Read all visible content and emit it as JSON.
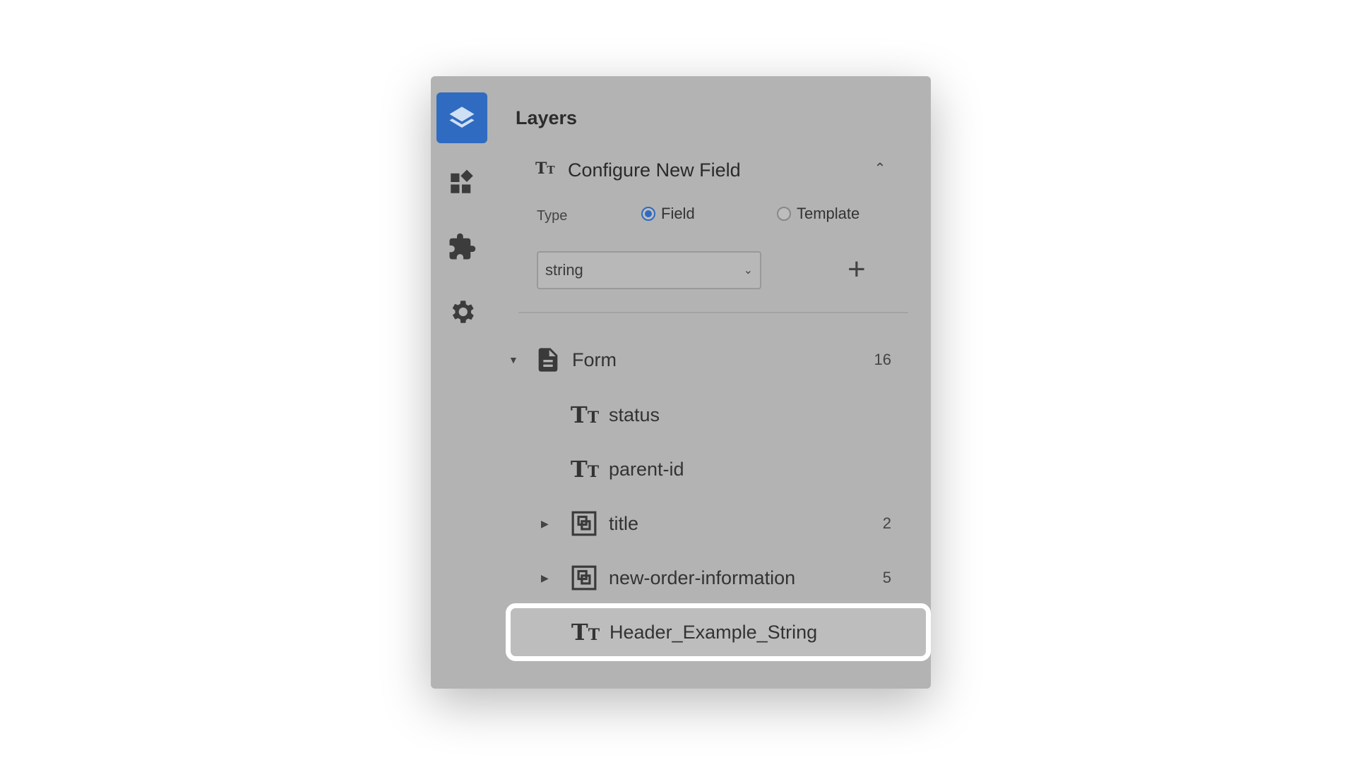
{
  "panel": {
    "title": "Layers"
  },
  "rail": [
    {
      "icon": "layers-icon",
      "active": true
    },
    {
      "icon": "dashboard-icon",
      "active": false
    },
    {
      "icon": "puzzle-icon",
      "active": false
    },
    {
      "icon": "gear-icon",
      "active": false
    }
  ],
  "configure": {
    "title": "Configure New Field",
    "type_label": "Type",
    "options": [
      {
        "label": "Field",
        "selected": true
      },
      {
        "label": "Template",
        "selected": false
      }
    ],
    "select_value": "string"
  },
  "tree": {
    "root": {
      "label": "Form",
      "count": "16"
    },
    "items": [
      {
        "label": "status",
        "kind": "text"
      },
      {
        "label": "parent-id",
        "kind": "text"
      },
      {
        "label": "title",
        "kind": "group",
        "count": "2"
      },
      {
        "label": "new-order-information",
        "kind": "group",
        "count": "5"
      },
      {
        "label": "Header_Example_String",
        "kind": "text",
        "highlighted": true
      }
    ]
  },
  "colors": {
    "accent": "#2f6bc1",
    "panel_bg": "#b3b3b3",
    "highlight_border": "#ffffff"
  }
}
